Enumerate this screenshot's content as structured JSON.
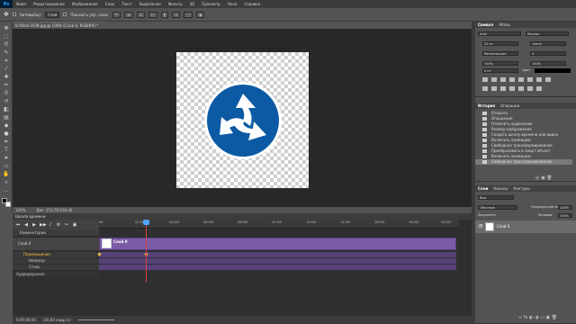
{
  "app": {
    "logo": "Ps"
  },
  "menu": [
    "Файл",
    "Редактирование",
    "Изображение",
    "Слои",
    "Текст",
    "Выделение",
    "Фильтр",
    "3D",
    "Просмотр",
    "Окно",
    "Справка"
  ],
  "options": {
    "auto_select_label": "Автовыбор:",
    "auto_select_value": "Слой",
    "show_controls_label": "Показать упр. элем."
  },
  "document": {
    "tab_title": "b740cb-1939.jpg @ 100% (Слой 0, RGB/8#) *",
    "zoom": "100%",
    "doc_size": "Док: 253,7K/338,4K",
    "sign_color": "#0b5aa3"
  },
  "timeline": {
    "header": "Шкала времени",
    "ruler_ticks": [
      "00",
      "02:00f",
      "04:00f",
      "06:00f",
      "08:00f",
      "10:00f",
      "12:00f",
      "14:00f",
      "16:00f",
      "18:00f",
      "20:00f"
    ],
    "keyframe_label": "Комментарии",
    "layer_name": "Слой 0",
    "clip_label": "Слой 0",
    "sub_rows": [
      "Перемещение",
      "Непрозр.",
      "Стиль"
    ],
    "audio_label": "Аудиодорожка",
    "timecode": "0:00:00:00",
    "fps": "(30,00 кадр./с)",
    "clip_color": "#7c5ba6"
  },
  "character_panel": {
    "tabs": [
      "Символ",
      "Абзац"
    ],
    "font": "Arial",
    "style": "Regular",
    "size": "20 пт",
    "leading": "(Авто)",
    "tracking": "Метрические",
    "kerning": "0",
    "vscale": "100%",
    "hscale": "100%",
    "baseline": "0 пт",
    "color_label": "Цвет:"
  },
  "history_panel": {
    "tabs": [
      "История",
      "Операции"
    ],
    "items": [
      "Открыть",
      "Опоцкание",
      "Отменить выделение",
      "Размер изображения",
      "Создать шкалу времени для видео",
      "Включить анимацию",
      "Свободное трансформирование",
      "Преобразовать в смарт-объект",
      "Включить анимацию",
      "Свободное трансформирование"
    ]
  },
  "layers_panel": {
    "tabs": [
      "Слои",
      "Каналы",
      "Контуры"
    ],
    "filter": "Вид",
    "blend_mode": "Обычные",
    "opacity_label": "Непрозрачность:",
    "opacity": "100%",
    "lock_label": "Закрепить:",
    "fill_label": "Заливка:",
    "fill": "100%",
    "layer_name": "Слой 0"
  }
}
